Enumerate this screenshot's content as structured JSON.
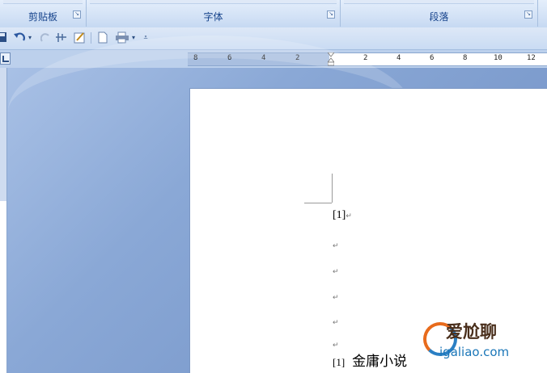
{
  "ribbon": {
    "groups": [
      {
        "label": "剪贴板"
      },
      {
        "label": "字体"
      },
      {
        "label": "段落"
      }
    ]
  },
  "qat": {
    "icons": [
      "save-icon",
      "undo-icon",
      "dropdown-icon",
      "redo-icon",
      "format-painter-icon",
      "spelling-icon",
      "new-doc-icon",
      "print-icon",
      "dropdown-icon",
      "customize-icon"
    ]
  },
  "ruler": {
    "ticks": [
      "8",
      "6",
      "4",
      "2",
      "2",
      "4",
      "6",
      "8",
      "10",
      "12"
    ]
  },
  "document": {
    "ref_label": "[1]",
    "para_mark": "↵",
    "second_ref": "[1]",
    "body_text": "金庸小说"
  },
  "watermark": {
    "line1": "爱尬聊",
    "line2": "igaliao.com"
  },
  "colors": {
    "ribbon_text": "#15428b",
    "workspace": "#7e9cc9"
  }
}
